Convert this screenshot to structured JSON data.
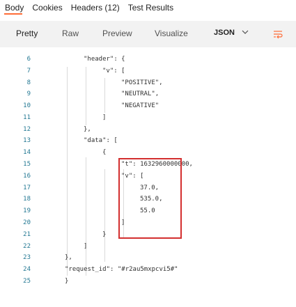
{
  "response_tabs": {
    "body": "Body",
    "cookies": "Cookies",
    "headers": "Headers (12)",
    "test_results": "Test Results"
  },
  "view_modes": {
    "pretty": "Pretty",
    "raw": "Raw",
    "preview": "Preview",
    "visualize": "Visualize",
    "format": "JSON"
  },
  "lines": [
    {
      "num": "6",
      "text": "\"header\": {"
    },
    {
      "num": "7",
      "text": "\"v\": ["
    },
    {
      "num": "8",
      "text": "\"POSITIVE\","
    },
    {
      "num": "9",
      "text": "\"NEUTRAL\","
    },
    {
      "num": "10",
      "text": "\"NEGATIVE\""
    },
    {
      "num": "11",
      "text": "]"
    },
    {
      "num": "12",
      "text": "},"
    },
    {
      "num": "13",
      "text": "\"data\": ["
    },
    {
      "num": "14",
      "text": "{"
    },
    {
      "num": "15",
      "text": "\"t\": 1632960000000,"
    },
    {
      "num": "16",
      "text": "\"v\": ["
    },
    {
      "num": "17",
      "text": "37.0,"
    },
    {
      "num": "18",
      "text": "535.0,"
    },
    {
      "num": "19",
      "text": "55.0"
    },
    {
      "num": "20",
      "text": "]"
    },
    {
      "num": "21",
      "text": "}"
    },
    {
      "num": "22",
      "text": "]"
    },
    {
      "num": "23",
      "text": "},"
    },
    {
      "num": "24",
      "text": "\"request_id\": \"#r2au5mxpcvi5#\""
    },
    {
      "num": "25",
      "text": "}"
    }
  ],
  "colors": {
    "accent": "#ff6c37",
    "highlight_border": "#d32f2f",
    "line_number": "#237893"
  }
}
